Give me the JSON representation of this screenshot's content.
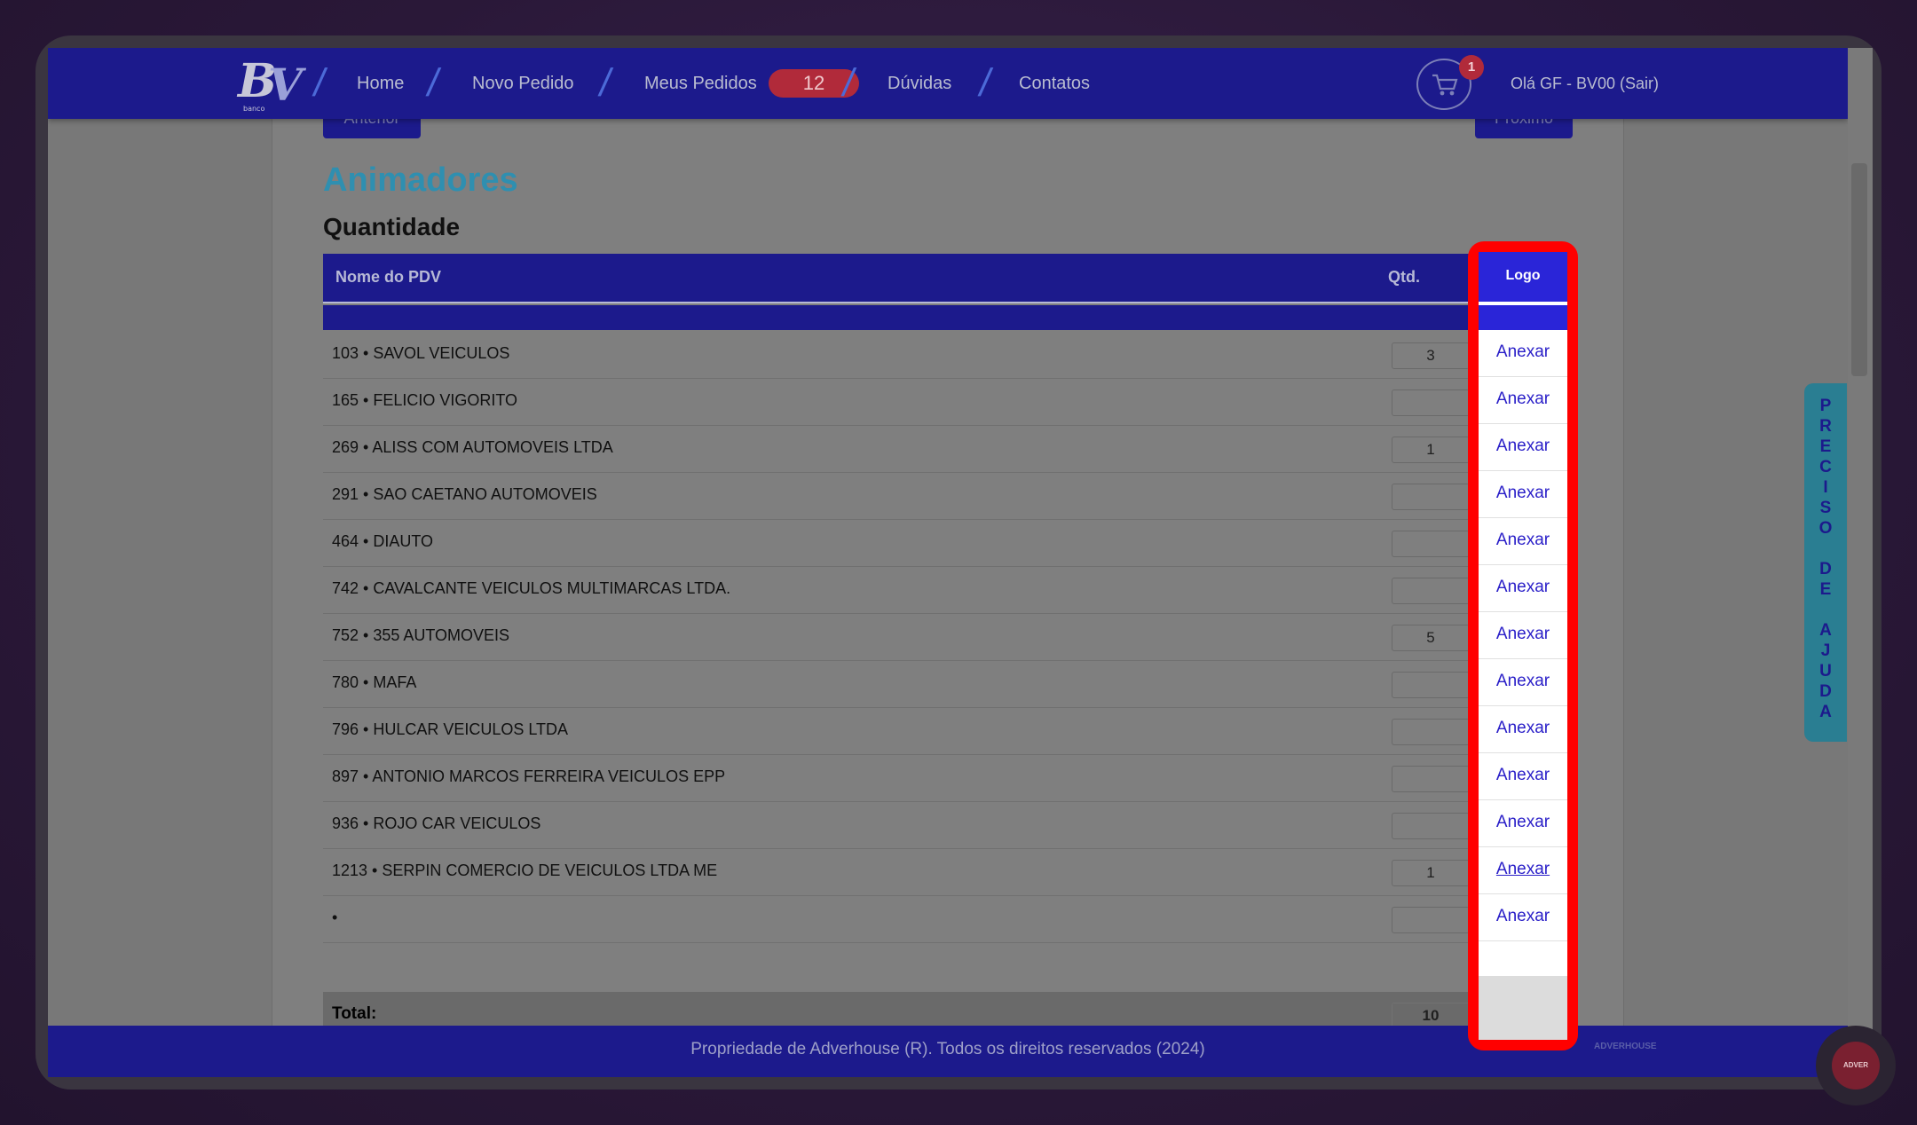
{
  "nav": {
    "logo_letters": "BV",
    "logo_sub": "banco",
    "links": [
      "Home",
      "Novo Pedido",
      "Meus Pedidos",
      "Dúvidas",
      "Contatos"
    ],
    "orders_badge": "12",
    "cart_count": "1",
    "greeting": "Olá GF - BV00 (Sair)"
  },
  "pager": {
    "prev": "Anterior",
    "next": "Próximo"
  },
  "page": {
    "title": "Animadores",
    "subtitle": "Quantidade"
  },
  "table": {
    "headers": {
      "name": "Nome do PDV",
      "qty": "Qtd.",
      "logo": "Logo"
    },
    "rows": [
      {
        "name": "103 • SAVOL VEICULOS",
        "qty": "3",
        "action": "Anexar"
      },
      {
        "name": "165 • FELICIO VIGORITO",
        "qty": "",
        "action": "Anexar"
      },
      {
        "name": "269 • ALISS COM AUTOMOVEIS LTDA",
        "qty": "1",
        "action": "Anexar"
      },
      {
        "name": "291 • SAO CAETANO AUTOMOVEIS",
        "qty": "",
        "action": "Anexar"
      },
      {
        "name": "464 • DIAUTO",
        "qty": "",
        "action": "Anexar"
      },
      {
        "name": "742 • CAVALCANTE VEICULOS MULTIMARCAS LTDA.",
        "qty": "",
        "action": "Anexar"
      },
      {
        "name": "752 • 355 AUTOMOVEIS",
        "qty": "5",
        "action": "Anexar"
      },
      {
        "name": "780 • MAFA",
        "qty": "",
        "action": "Anexar"
      },
      {
        "name": "796 • HULCAR VEICULOS LTDA",
        "qty": "",
        "action": "Anexar"
      },
      {
        "name": "897 • ANTONIO MARCOS FERREIRA VEICULOS EPP",
        "qty": "",
        "action": "Anexar"
      },
      {
        "name": "936 • ROJO CAR VEICULOS",
        "qty": "",
        "action": "Anexar"
      },
      {
        "name": "1213 • SERPIN COMERCIO DE VEICULOS LTDA ME",
        "qty": "1",
        "action": "Anexar"
      },
      {
        "name": "•",
        "qty": "",
        "action": "Anexar"
      }
    ],
    "total_label": "Total:",
    "total_qty": "10"
  },
  "help_tab": {
    "text": "PRECISO DE AJUDA"
  },
  "footer": {
    "text": "Propriedade de Adverhouse (R). Todos os direitos reservados (2024)",
    "logo": "ADVERHOUSE"
  },
  "chat": {
    "label": "ADVER"
  },
  "colors": {
    "nav": "#1c1a8c",
    "highlight": "#ff0000",
    "title": "#2f8fb0",
    "link": "#2a1fc8"
  }
}
